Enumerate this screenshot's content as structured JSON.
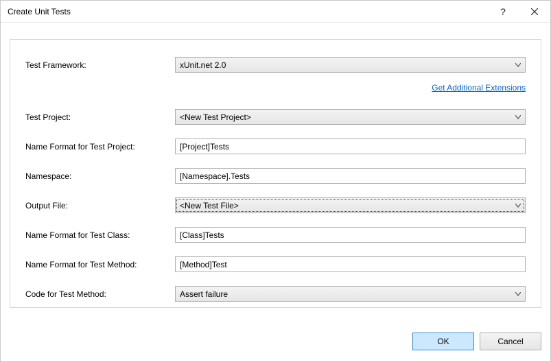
{
  "window": {
    "title": "Create Unit Tests"
  },
  "link": {
    "get_extensions": "Get Additional Extensions"
  },
  "labels": {
    "test_framework": "Test Framework:",
    "test_project": "Test Project:",
    "name_format_project": "Name Format for Test Project:",
    "namespace": "Namespace:",
    "output_file": "Output File:",
    "name_format_class": "Name Format for Test Class:",
    "name_format_method": "Name Format for Test Method:",
    "code_for_method": "Code for Test Method:"
  },
  "values": {
    "test_framework": "xUnit.net 2.0",
    "test_project": "<New Test Project>",
    "name_format_project": "[Project]Tests",
    "namespace": "[Namespace].Tests",
    "output_file": "<New Test File>",
    "name_format_class": "[Class]Tests",
    "name_format_method": "[Method]Test",
    "code_for_method": "Assert failure"
  },
  "buttons": {
    "ok": "OK",
    "cancel": "Cancel"
  }
}
